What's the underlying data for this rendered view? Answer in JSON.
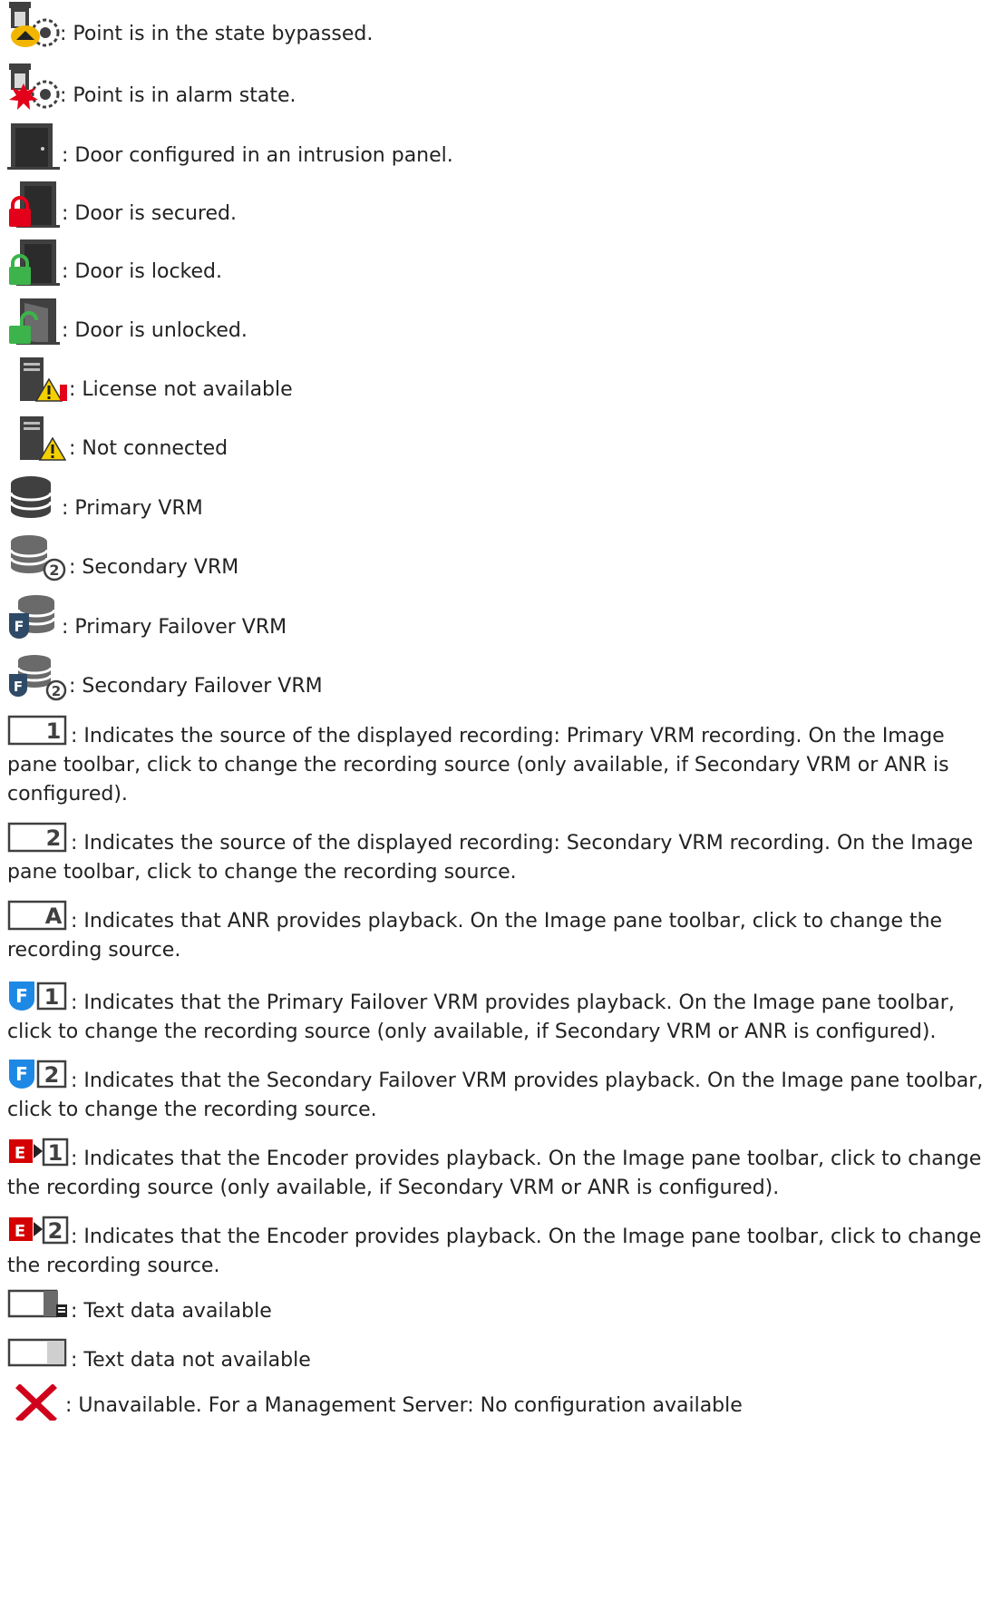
{
  "items": [
    {
      "icon": "point-bypassed-icon",
      "text": ": Point is in the state bypassed."
    },
    {
      "icon": "point-alarm-icon",
      "text": ": Point is in alarm state."
    },
    {
      "icon": "door-icon",
      "text": ": Door configured in an intrusion panel."
    },
    {
      "icon": "door-secured-icon",
      "text": ": Door is secured."
    },
    {
      "icon": "door-locked-icon",
      "text": ": Door is locked."
    },
    {
      "icon": "door-unlocked-icon",
      "text": ": Door is unlocked."
    },
    {
      "icon": "license-unavailable-icon",
      "text": ": License not available"
    },
    {
      "icon": "not-connected-icon",
      "text": ": Not connected"
    },
    {
      "icon": "primary-vrm-icon",
      "text": ": Primary VRM"
    },
    {
      "icon": "secondary-vrm-icon",
      "text": ": Secondary VRM"
    },
    {
      "icon": "primary-failover-vrm-icon",
      "text": ": Primary Failover VRM"
    },
    {
      "icon": "secondary-failover-vrm-icon",
      "text": ": Secondary Failover VRM"
    },
    {
      "icon": "source-1-icon",
      "text": ": Indicates the source of the displayed recording: Primary VRM recording. On the Image pane toolbar, click to change the recording source (only available, if Secondary VRM or ANR is configured)."
    },
    {
      "icon": "source-2-icon",
      "text": ": Indicates the source of the displayed recording: Secondary VRM recording. On the Image pane toolbar, click to change the recording source."
    },
    {
      "icon": "source-anr-icon",
      "text": ": Indicates that ANR provides playback. On the Image pane toolbar, click to change the recording source."
    },
    {
      "icon": "failover-1-icon",
      "text": ": Indicates that the Primary Failover VRM provides playback. On the Image pane toolbar, click to change the recording source (only available, if Secondary VRM or ANR is configured)."
    },
    {
      "icon": "failover-2-icon",
      "text": ": Indicates that the Secondary Failover VRM provides playback. On the Image pane toolbar, click to change the recording source."
    },
    {
      "icon": "encoder-1-icon",
      "text": ": Indicates that the Encoder provides playback. On the Image pane toolbar, click to change the recording source (only available, if Secondary VRM or ANR is configured)."
    },
    {
      "icon": "encoder-2-icon",
      "text": ": Indicates that the Encoder provides playback. On the Image pane toolbar, click to change the recording source."
    },
    {
      "icon": "text-data-icon",
      "text": ": Text data available"
    },
    {
      "icon": "no-text-data-icon",
      "text": ": Text data not available"
    },
    {
      "icon": "unavailable-x-icon",
      "text": ": Unavailable. For a Management Server: No configuration available"
    }
  ],
  "glyphs": {
    "source_1": "1",
    "source_2": "2",
    "source_anr": "A",
    "failover_f": "F",
    "failover_1": "1",
    "failover_2": "2",
    "encoder_e": "E",
    "encoder_1": "1",
    "encoder_2": "2"
  },
  "colors": {
    "text": "#222222",
    "alarm_red": "#e2001a",
    "lock_green": "#3cb44b",
    "warning_yellow": "#f5d000",
    "failover_blue": "#1e88e5",
    "encoder_red": "#d50000",
    "device_dark": "#404040",
    "x_red": "#d0021b"
  }
}
